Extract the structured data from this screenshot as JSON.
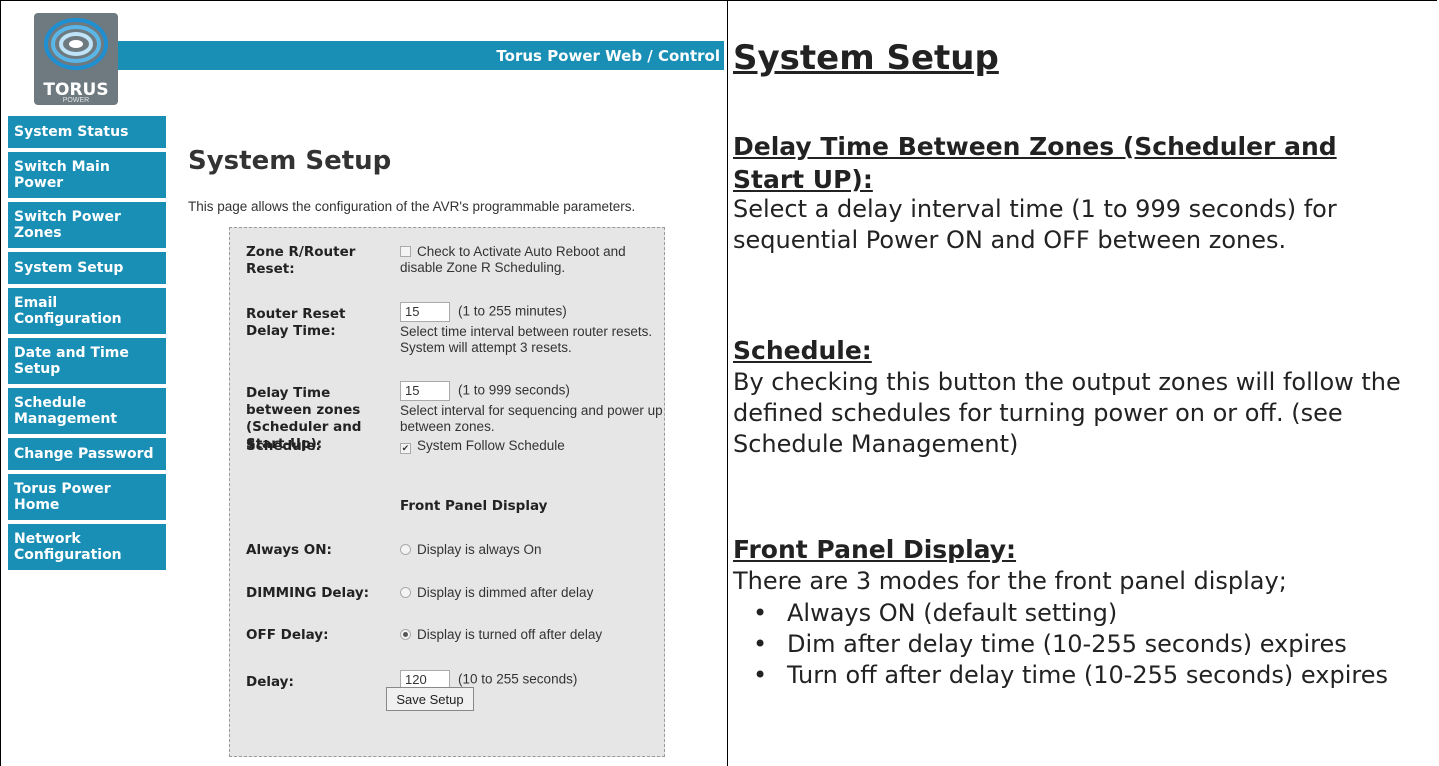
{
  "app": {
    "header_title": "Torus Power Web / Control",
    "logo_text": "TORUS",
    "logo_sub": "POWER"
  },
  "sidebar": {
    "items": [
      {
        "label": "System Status"
      },
      {
        "label": "Switch Main Power"
      },
      {
        "label": "Switch Power Zones"
      },
      {
        "label": "System Setup"
      },
      {
        "label": "Email Configuration"
      },
      {
        "label": "Date and Time Setup"
      },
      {
        "label": "Schedule Management"
      },
      {
        "label": "Change Password"
      },
      {
        "label": "Torus Power Home"
      },
      {
        "label": "Network Configuration"
      }
    ]
  },
  "main": {
    "title": "System Setup",
    "description": "This page allows the configuration of the AVR's programmable parameters.",
    "form": {
      "zone_r_label": "Zone R/Router Reset:",
      "zone_r_checkbox_text": "Check to Activate Auto Reboot and disable Zone R Scheduling.",
      "zone_r_checked": false,
      "router_delay_label": "Router Reset Delay Time:",
      "router_delay_value": "15",
      "router_delay_range": "(1 to 255 minutes)",
      "router_delay_help": "Select time interval between router resets. System will attempt 3 resets.",
      "zone_delay_label": "Delay Time between zones (Scheduler and Start-Up):",
      "zone_delay_value": "15",
      "zone_delay_range": "(1 to 999 seconds)",
      "zone_delay_help": "Select interval for sequencing and power up between zones.",
      "schedule_label": "Schedule:",
      "schedule_checkbox_text": "System Follow Schedule",
      "schedule_checked": true,
      "front_panel_heading": "Front Panel Display",
      "always_on_label": "Always ON:",
      "always_on_text": "Display is always On",
      "dimming_label": "DIMMING Delay:",
      "dimming_text": "Display is dimmed after delay",
      "off_label": "OFF Delay:",
      "off_text": "Display is turned off after delay",
      "selected_mode": "off",
      "delay_label": "Delay:",
      "delay_value": "120",
      "delay_range": "(10 to 255 seconds)",
      "save_label": "Save Setup"
    }
  },
  "doc": {
    "title": "System Setup",
    "delay_heading": "Delay Time Between Zones (Scheduler and Start UP):",
    "delay_body": "Select a delay interval time (1 to 999 seconds) for sequential Power ON and OFF between zones.",
    "schedule_heading": "Schedule:",
    "schedule_body": "By checking this button the output zones will follow the defined schedules for turning power on or off. (see Schedule Management)",
    "fp_heading": "Front Panel Display:",
    "fp_body": "There are 3 modes for the front panel display;",
    "fp_bullets": [
      "Always ON (default setting)",
      "Dim after delay time (10-255 seconds) expires",
      "Turn off after delay time (10-255 seconds) expires"
    ]
  },
  "colors": {
    "nav_blue": "#1a8fb5",
    "panel_gray": "#e6e6e6"
  }
}
